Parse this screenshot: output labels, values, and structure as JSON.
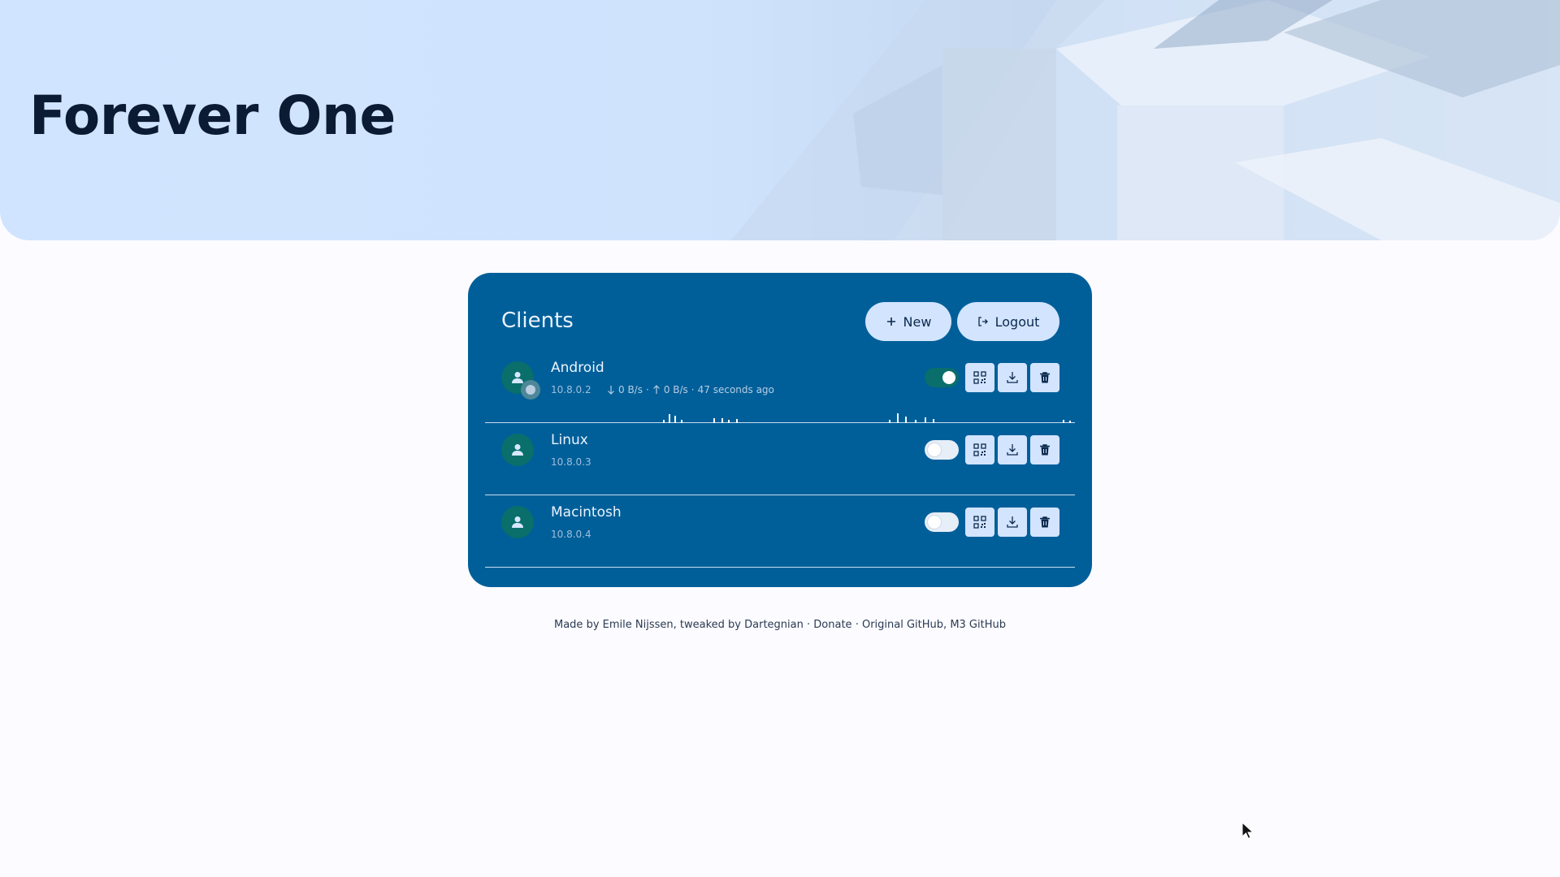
{
  "header": {
    "title": "Forever One"
  },
  "clients_card": {
    "title": "Clients",
    "new_label": "New",
    "logout_label": "Logout",
    "clients": [
      {
        "name": "Android",
        "ip": "10.8.0.2",
        "enabled": true,
        "online": true,
        "download_rate": "0 B/s",
        "upload_rate": "0 B/s",
        "last_seen": "47 seconds ago",
        "separator": "·"
      },
      {
        "name": "Linux",
        "ip": "10.8.0.3",
        "enabled": false
      },
      {
        "name": "Macintosh",
        "ip": "10.8.0.4",
        "enabled": false
      }
    ]
  },
  "footer": {
    "made_by": "Made by",
    "author": "Emile Nijssen",
    "tweaked_by": ", tweaked by",
    "tweaker": "Dartegnian",
    "sep": "·",
    "donate": "Donate",
    "original_github": "Original GitHub",
    "comma": ",",
    "m3_github": "M3 GitHub"
  },
  "colors": {
    "card_bg": "#005f99",
    "button_bg": "#d3e4ff",
    "avatar_bg": "#0a6e6b",
    "page_bg": "#fcfbff"
  },
  "icons": {
    "new": "plus-icon",
    "logout": "logout-icon",
    "avatar": "person-icon",
    "qr": "qr-code-icon",
    "download": "download-icon",
    "delete": "trash-icon"
  }
}
